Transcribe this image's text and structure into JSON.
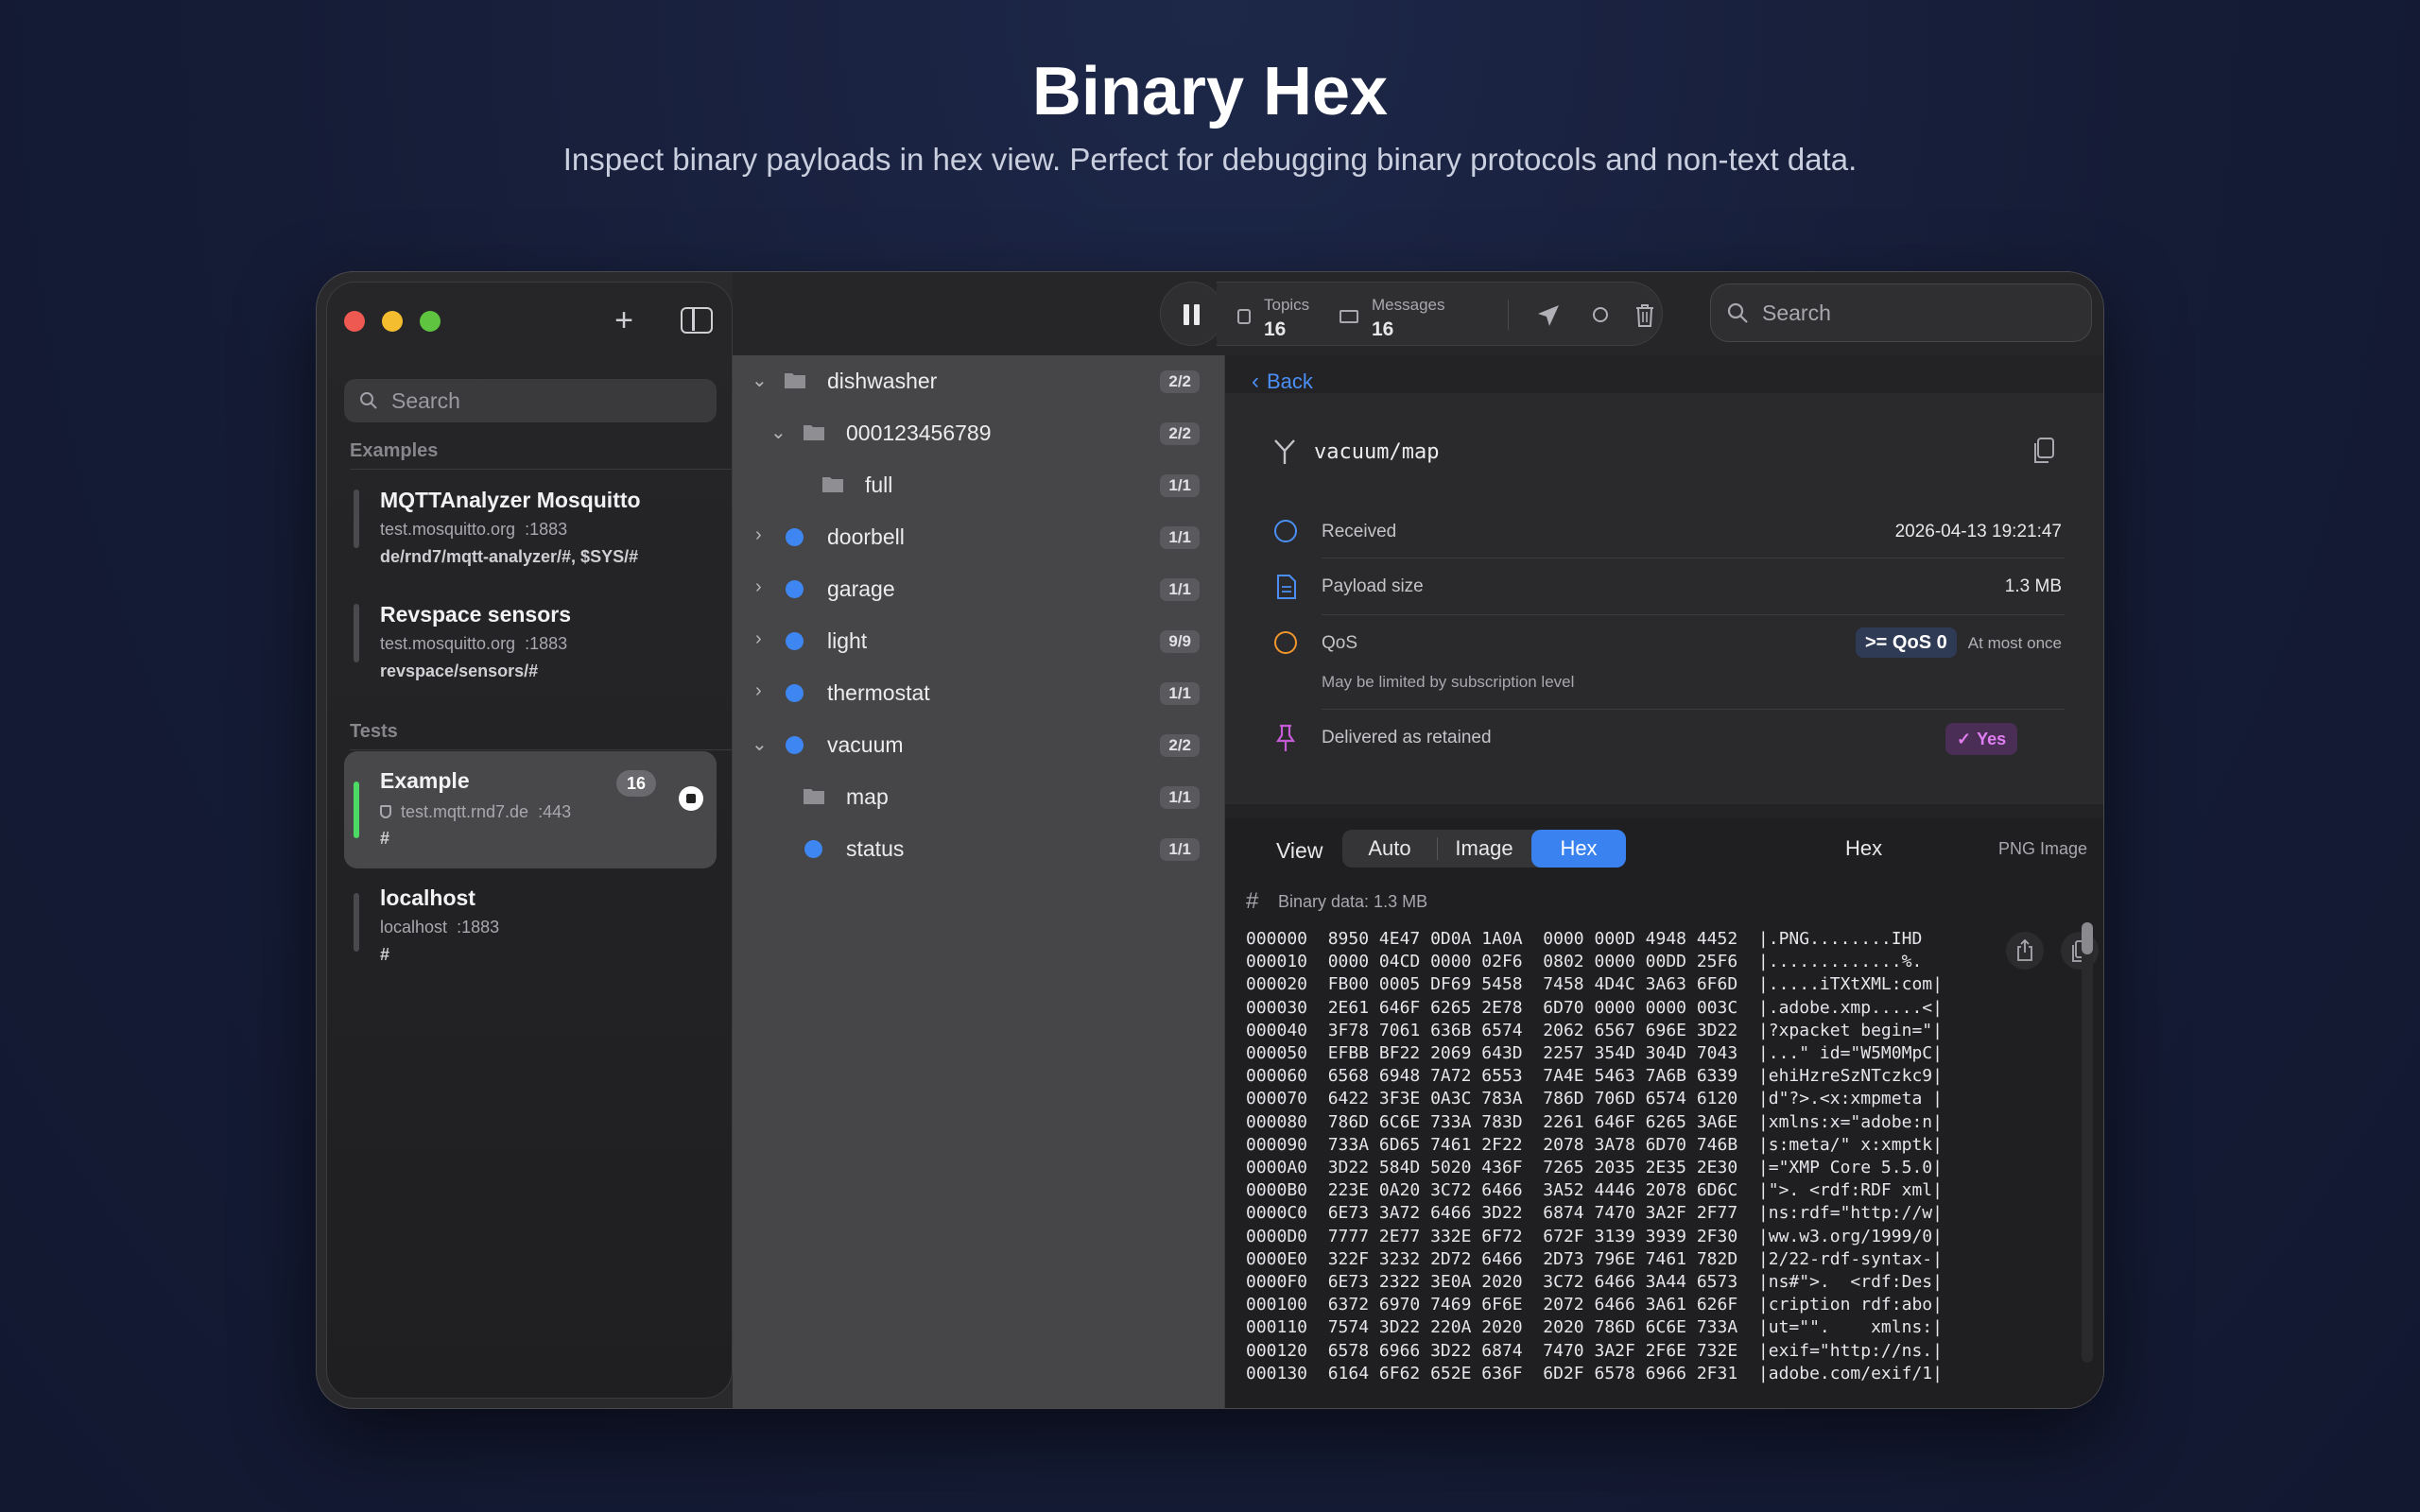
{
  "hero": {
    "title": "Binary Hex",
    "subtitle": "Inspect binary payloads in hex view. Perfect for debugging binary protocols and non-text data."
  },
  "sidebar": {
    "search_placeholder": "Search",
    "sections": {
      "examples": "Examples",
      "tests": "Tests"
    },
    "brokers": [
      {
        "name": "MQTTAnalyzer Mosquitto",
        "host": "test.mosquitto.org",
        "port": ":1883",
        "topic": "de/rnd7/mqtt-analyzer/#, $SYS/#"
      },
      {
        "name": "Revspace sensors",
        "host": "test.mosquitto.org",
        "port": ":1883",
        "topic": "revspace/sensors/#"
      },
      {
        "name": "Example",
        "host": "test.mqtt.rnd7.de",
        "port": ":443",
        "topic": "#",
        "count": "16"
      },
      {
        "name": "localhost",
        "host": "localhost",
        "port": ":1883",
        "topic": "#"
      }
    ]
  },
  "toolbar": {
    "topics_label": "Topics",
    "topics_value": "16",
    "messages_label": "Messages",
    "messages_value": "16",
    "search_placeholder": "Search"
  },
  "tree": [
    {
      "label": "dishwasher",
      "badge": "2/2",
      "kind": "folder"
    },
    {
      "label": "000123456789",
      "badge": "2/2",
      "kind": "folder"
    },
    {
      "label": "full",
      "badge": "1/1",
      "kind": "folder"
    },
    {
      "label": "doorbell",
      "badge": "1/1",
      "kind": "dot"
    },
    {
      "label": "garage",
      "badge": "1/1",
      "kind": "dot"
    },
    {
      "label": "light",
      "badge": "9/9",
      "kind": "dot"
    },
    {
      "label": "thermostat",
      "badge": "1/1",
      "kind": "dot"
    },
    {
      "label": "vacuum",
      "badge": "2/2",
      "kind": "dot"
    },
    {
      "label": "map",
      "badge": "1/1",
      "kind": "folder"
    },
    {
      "label": "status",
      "badge": "1/1",
      "kind": "dot"
    }
  ],
  "detail": {
    "back": "Back",
    "topic": "vacuum/map",
    "received_label": "Received",
    "received_value": "2026-04-13 19:21:47",
    "size_label": "Payload size",
    "size_value": "1.3 MB",
    "qos_label": "QoS",
    "qos_value": ">= QoS 0",
    "qos_desc": "At most once",
    "qos_note": "May be limited by subscription level",
    "retained_label": "Delivered as retained",
    "retained_value": "Yes",
    "view_label": "View",
    "tabs": [
      "Auto",
      "Image",
      "Hex"
    ],
    "type_label": "PNG Image",
    "binary_label": "Binary data: 1.3 MB"
  },
  "hex_lines": [
    [
      "000000",
      "8950 4E47 0D0A 1A0A  0000 000D 4948 4452",
      "|.PNG........IHD"
    ],
    [
      "000010",
      "0000 04CD 0000 02F6  0802 0000 00DD 25F6",
      "|.............%."
    ],
    [
      "000020",
      "FB00 0005 DF69 5458  7458 4D4C 3A63 6F6D",
      "|.....iTXtXML:com|"
    ],
    [
      "000030",
      "2E61 646F 6265 2E78  6D70 0000 0000 003C",
      "|.adobe.xmp.....<|"
    ],
    [
      "000040",
      "3F78 7061 636B 6574  2062 6567 696E 3D22",
      "|?xpacket begin=\"|"
    ],
    [
      "000050",
      "EFBB BF22 2069 643D  2257 354D 304D 7043",
      "|...\" id=\"W5M0MpC|"
    ],
    [
      "000060",
      "6568 6948 7A72 6553  7A4E 5463 7A6B 6339",
      "|ehiHzreSzNTczkc9|"
    ],
    [
      "000070",
      "6422 3F3E 0A3C 783A  786D 706D 6574 6120",
      "|d\"?>.<x:xmpmeta |"
    ],
    [
      "000080",
      "786D 6C6E 733A 783D  2261 646F 6265 3A6E",
      "|xmlns:x=\"adobe:n|"
    ],
    [
      "000090",
      "733A 6D65 7461 2F22  2078 3A78 6D70 746B",
      "|s:meta/\" x:xmptk|"
    ],
    [
      "0000A0",
      "3D22 584D 5020 436F  7265 2035 2E35 2E30",
      "|=\"XMP Core 5.5.0|"
    ],
    [
      "0000B0",
      "223E 0A20 3C72 6466  3A52 4446 2078 6D6C",
      "|\">. <rdf:RDF xml|"
    ],
    [
      "0000C0",
      "6E73 3A72 6466 3D22  6874 7470 3A2F 2F77",
      "|ns:rdf=\"http://w|"
    ],
    [
      "0000D0",
      "7777 2E77 332E 6F72  672F 3139 3939 2F30",
      "|ww.w3.org/1999/0|"
    ],
    [
      "0000E0",
      "322F 3232 2D72 6466  2D73 796E 7461 782D",
      "|2/22-rdf-syntax-|"
    ],
    [
      "0000F0",
      "6E73 2322 3E0A 2020  3C72 6466 3A44 6573",
      "|ns#\">.  <rdf:Des|"
    ],
    [
      "000100",
      "6372 6970 7469 6F6E  2072 6466 3A61 626F",
      "|cription rdf:abo|"
    ],
    [
      "000110",
      "7574 3D22 220A 2020  2020 786D 6C6E 733A",
      "|ut=\"\".    xmlns:|"
    ],
    [
      "000120",
      "6578 6966 3D22 6874  7470 3A2F 2F6E 732E",
      "|exif=\"http://ns.|"
    ],
    [
      "000130",
      "6164 6F62 652E 636F  6D2F 6578 6966 2F31",
      "|adobe.com/exif/1|"
    ]
  ]
}
